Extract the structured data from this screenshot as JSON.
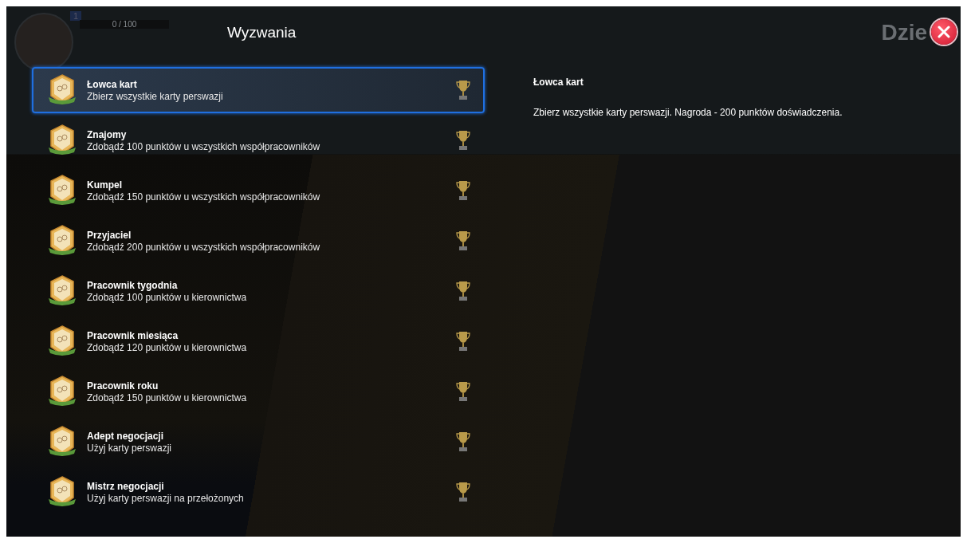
{
  "player": {
    "level": "1",
    "xp": "0 / 100"
  },
  "title": "Wyzwania",
  "day_label": "Dzie",
  "challenges": [
    {
      "name": "Łowca kart",
      "description": "Zbierz wszystkie karty perswazji",
      "selected": true
    },
    {
      "name": "Znajomy",
      "description": "Zdobądź 100 punktów u wszystkich współpracowników",
      "selected": false
    },
    {
      "name": "Kumpel",
      "description": "Zdobądź 150 punktów u wszystkich współpracowników",
      "selected": false
    },
    {
      "name": "Przyjaciel",
      "description": "Zdobądź 200 punktów u wszystkich współpracowników",
      "selected": false
    },
    {
      "name": "Pracownik tygodnia",
      "description": "Zdobądź 100 punktów u kierownictwa",
      "selected": false
    },
    {
      "name": "Pracownik miesiąca",
      "description": "Zdobądź 120 punktów u kierownictwa",
      "selected": false
    },
    {
      "name": "Pracownik roku",
      "description": "Zdobądź 150 punktów u kierownictwa",
      "selected": false
    },
    {
      "name": "Adept negocjacji",
      "description": "Użyj karty perswazji",
      "selected": false
    },
    {
      "name": "Mistrz negocjacji",
      "description": "Użyj karty perswazji na przełożonych",
      "selected": false
    }
  ],
  "detail": {
    "title": "Łowca kart",
    "description": "Zbierz wszystkie karty perswazji. Nagroda - 200 punktów doświadczenia."
  }
}
